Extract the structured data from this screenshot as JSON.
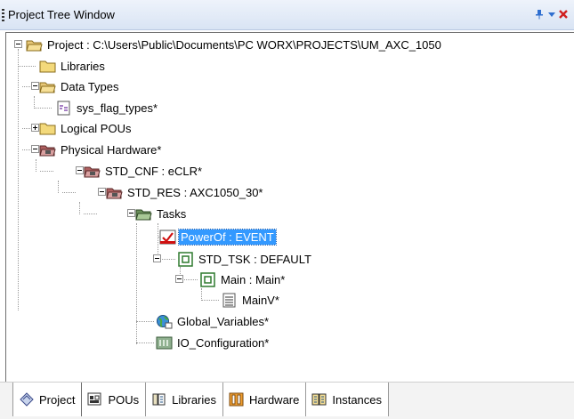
{
  "window": {
    "title": "Project Tree Window",
    "pin_icon": "pin-icon",
    "menu_icon": "dropdown-arrow-icon",
    "close_icon": "close-icon"
  },
  "tree": {
    "project": "Project : C:\\Users\\Public\\Documents\\PC WORX\\PROJECTS\\UM_AXC_1050",
    "libraries": "Libraries",
    "data_types": "Data Types",
    "sys_flag_types": "sys_flag_types*",
    "logical_pous": "Logical POUs",
    "physical_hardware": "Physical Hardware*",
    "std_cnf": "STD_CNF : eCLR*",
    "std_res": "STD_RES : AXC1050_30*",
    "tasks": "Tasks",
    "powerof": "PowerOf : EVENT",
    "std_tsk": "STD_TSK : DEFAULT",
    "main": "Main : Main*",
    "mainv": "MainV*",
    "global_variables": "Global_Variables*",
    "io_configuration": "IO_Configuration*"
  },
  "tabs": {
    "project": "Project",
    "pous": "POUs",
    "libraries": "Libraries",
    "hardware": "Hardware",
    "instances": "Instances"
  },
  "colors": {
    "selection": "#3399ff",
    "title_bar": "#dfe8f6"
  }
}
